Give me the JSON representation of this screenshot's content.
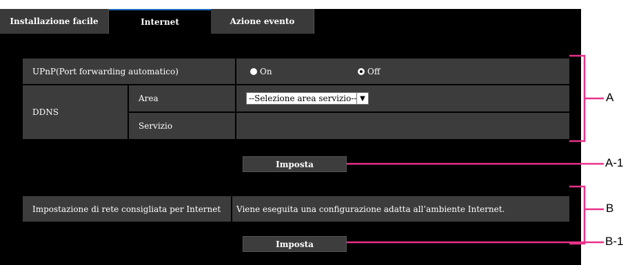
{
  "tabs": [
    {
      "label": "Installazione facile",
      "active": false
    },
    {
      "label": "Internet",
      "active": true
    },
    {
      "label": "Azione evento",
      "active": false
    }
  ],
  "upnp": {
    "label": "UPnP(Port forwarding automatico)",
    "options": [
      {
        "label": "On",
        "selected": true
      },
      {
        "label": "Off",
        "selected": false
      }
    ]
  },
  "ddns": {
    "label": "DDNS",
    "area_label": "Area",
    "area_select_value": "--Selezione area servizio--",
    "service_label": "Servizio"
  },
  "set_button_1": "Imposta",
  "recommended": {
    "label": "Impostazione di rete consigliata per Internet",
    "description": "Viene eseguita una configurazione adatta all’ambiente Internet."
  },
  "set_button_2": "Imposta",
  "callouts": [
    "A",
    "A-1",
    "B",
    "B-1"
  ],
  "colors": {
    "callout": "#e8318a",
    "panel": "#000000",
    "cell": "#3c3c3c",
    "active_tab_border": "#1e6fbf"
  }
}
